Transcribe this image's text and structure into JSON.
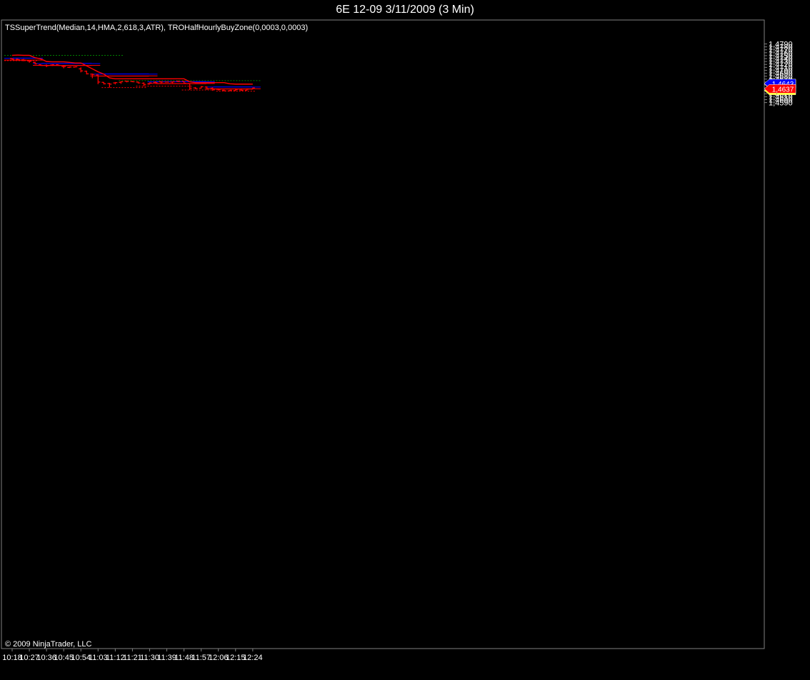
{
  "window": {
    "title": "6E 12-09  3/11/2009 (3 Min)"
  },
  "indicator_label": "TSSuperTrend(Median,14,HMA,2,618,3,ATR), TROHalfHourlyBuyZone(0,0003,0,0003)",
  "copyright": "© 2009 NinjaTrader, LLC",
  "colors": {
    "background": "#000000",
    "bars": "#ff0000",
    "supertrend": "#ff0000",
    "blue_zone": "#0000ff",
    "blue_zone_fill": "#000068",
    "red_zone_fill": "#6b0000",
    "red_zone_line": "#ff0000",
    "green_dotted": "#008000",
    "axis_text": "#ffffff",
    "frame": "#808080"
  },
  "price_markers": [
    {
      "label": "1,4653",
      "value": 1.4653,
      "color": "#ff0000"
    },
    {
      "label": "1,4643",
      "value": 1.4643,
      "color": "#0000ff"
    },
    {
      "label": "1,4641",
      "value": 1.4641,
      "color": "#ffff00"
    },
    {
      "label": "1,4637",
      "value": 1.4637,
      "color": "#ff0000"
    }
  ],
  "chart_data": {
    "type": "ohlc",
    "title": "6E 12-09  3/11/2009 (3 Min)",
    "ylim": [
      1.4582,
      1.4797
    ],
    "x_ticks": [
      "10:18",
      "10:27",
      "10:36",
      "10:45",
      "10:54",
      "11:03",
      "11:12",
      "11:21",
      "11:30",
      "11:39",
      "11:48",
      "11:57",
      "12:06",
      "12:15",
      "12:24"
    ],
    "x_tick_index": [
      0,
      3,
      6,
      9,
      12,
      15,
      18,
      21,
      24,
      27,
      30,
      33,
      36,
      39,
      42
    ],
    "y_ticks": [
      "1,4590",
      "1,4600",
      "1,4610",
      "1,4620",
      "1,4630",
      "1,4640",
      "1,4650",
      "1,4660",
      "1,4670",
      "1,4680",
      "1,4690",
      "1,4700",
      "1,4710",
      "1,4720",
      "1,4730",
      "1,4740",
      "1,4750",
      "1,4760",
      "1,4770",
      "1,4780",
      "1,4790"
    ],
    "y_tick_values": [
      1.459,
      1.46,
      1.461,
      1.462,
      1.463,
      1.464,
      1.465,
      1.466,
      1.467,
      1.468,
      1.469,
      1.47,
      1.471,
      1.472,
      1.473,
      1.474,
      1.475,
      1.476,
      1.477,
      1.478,
      1.479
    ],
    "bars": [
      {
        "t": "10:18",
        "o": 1.474,
        "h": 1.4742,
        "l": 1.4736,
        "c": 1.4738
      },
      {
        "t": "10:21",
        "o": 1.4738,
        "h": 1.474,
        "l": 1.4734,
        "c": 1.4736
      },
      {
        "t": "10:24",
        "o": 1.4736,
        "h": 1.4739,
        "l": 1.4731,
        "c": 1.4735
      },
      {
        "t": "10:27",
        "o": 1.4732,
        "h": 1.4733,
        "l": 1.4726,
        "c": 1.4731
      },
      {
        "t": "10:30",
        "o": 1.4727,
        "h": 1.473,
        "l": 1.472,
        "c": 1.4722
      },
      {
        "t": "10:33",
        "o": 1.4719,
        "h": 1.4721,
        "l": 1.4715,
        "c": 1.4717
      },
      {
        "t": "10:36",
        "o": 1.4717,
        "h": 1.472,
        "l": 1.4711,
        "c": 1.4716
      },
      {
        "t": "10:39",
        "o": 1.4718,
        "h": 1.4721,
        "l": 1.4715,
        "c": 1.4719
      },
      {
        "t": "10:42",
        "o": 1.4719,
        "h": 1.4721,
        "l": 1.4716,
        "c": 1.4717
      },
      {
        "t": "10:45",
        "o": 1.4713,
        "h": 1.4717,
        "l": 1.4707,
        "c": 1.4713
      },
      {
        "t": "10:48",
        "o": 1.471,
        "h": 1.4712,
        "l": 1.4708,
        "c": 1.4711
      },
      {
        "t": "10:51",
        "o": 1.4711,
        "h": 1.4713,
        "l": 1.471,
        "c": 1.4712
      },
      {
        "t": "10:54",
        "o": 1.4705,
        "h": 1.471,
        "l": 1.4693,
        "c": 1.4698
      },
      {
        "t": "10:57",
        "o": 1.4697,
        "h": 1.4699,
        "l": 1.4686,
        "c": 1.4688
      },
      {
        "t": "11:00",
        "o": 1.4687,
        "h": 1.4689,
        "l": 1.4673,
        "c": 1.4686
      },
      {
        "t": "11:03",
        "o": 1.4684,
        "h": 1.4686,
        "l": 1.4653,
        "c": 1.466
      },
      {
        "t": "11:06",
        "o": 1.4659,
        "h": 1.466,
        "l": 1.4652,
        "c": 1.4654
      },
      {
        "t": "11:09",
        "o": 1.4655,
        "h": 1.4657,
        "l": 1.4641,
        "c": 1.4653
      },
      {
        "t": "11:12",
        "o": 1.4657,
        "h": 1.466,
        "l": 1.4652,
        "c": 1.4658
      },
      {
        "t": "11:15",
        "o": 1.4659,
        "h": 1.4663,
        "l": 1.4654,
        "c": 1.4661
      },
      {
        "t": "11:18",
        "o": 1.4663,
        "h": 1.4665,
        "l": 1.4659,
        "c": 1.4662
      },
      {
        "t": "11:21",
        "o": 1.4662,
        "h": 1.4664,
        "l": 1.466,
        "c": 1.4661
      },
      {
        "t": "11:24",
        "o": 1.466,
        "h": 1.4662,
        "l": 1.4655,
        "c": 1.4657
      },
      {
        "t": "11:27",
        "o": 1.4656,
        "h": 1.4659,
        "l": 1.4646,
        "c": 1.4652
      },
      {
        "t": "11:30",
        "o": 1.4653,
        "h": 1.4659,
        "l": 1.4652,
        "c": 1.4657
      },
      {
        "t": "11:33",
        "o": 1.4659,
        "h": 1.4663,
        "l": 1.4657,
        "c": 1.4658
      },
      {
        "t": "11:36",
        "o": 1.4661,
        "h": 1.4663,
        "l": 1.4656,
        "c": 1.466
      },
      {
        "t": "11:39",
        "o": 1.466,
        "h": 1.4661,
        "l": 1.4659,
        "c": 1.466
      },
      {
        "t": "11:42",
        "o": 1.466,
        "h": 1.4662,
        "l": 1.4656,
        "c": 1.4661
      },
      {
        "t": "11:45",
        "o": 1.4663,
        "h": 1.4665,
        "l": 1.466,
        "c": 1.4662
      },
      {
        "t": "11:48",
        "o": 1.4663,
        "h": 1.4664,
        "l": 1.4655,
        "c": 1.4656
      },
      {
        "t": "11:51",
        "o": 1.4655,
        "h": 1.4656,
        "l": 1.4633,
        "c": 1.4639
      },
      {
        "t": "11:54",
        "o": 1.464,
        "h": 1.4643,
        "l": 1.4636,
        "c": 1.4638
      },
      {
        "t": "11:57",
        "o": 1.4639,
        "h": 1.4646,
        "l": 1.4638,
        "c": 1.4644
      },
      {
        "t": "12:00",
        "o": 1.4643,
        "h": 1.4645,
        "l": 1.4634,
        "c": 1.4637
      },
      {
        "t": "12:03",
        "o": 1.4639,
        "h": 1.4642,
        "l": 1.463,
        "c": 1.4636
      },
      {
        "t": "12:06",
        "o": 1.4635,
        "h": 1.4638,
        "l": 1.4631,
        "c": 1.4634
      },
      {
        "t": "12:09",
        "o": 1.4632,
        "h": 1.4634,
        "l": 1.4629,
        "c": 1.463
      },
      {
        "t": "12:12",
        "o": 1.463,
        "h": 1.4633,
        "l": 1.4629,
        "c": 1.4632
      },
      {
        "t": "12:15",
        "o": 1.4631,
        "h": 1.4638,
        "l": 1.463,
        "c": 1.4634
      },
      {
        "t": "12:18",
        "o": 1.4633,
        "h": 1.4638,
        "l": 1.463,
        "c": 1.4632
      },
      {
        "t": "12:21",
        "o": 1.4632,
        "h": 1.4638,
        "l": 1.4631,
        "c": 1.4636
      },
      {
        "t": "12:24",
        "o": 1.4636,
        "h": 1.4641,
        "l": 1.4635,
        "c": 1.464
      }
    ],
    "supertrend": [
      {
        "t": "10:18",
        "v": 1.4751
      },
      {
        "t": "10:21",
        "v": 1.4752
      },
      {
        "t": "10:24",
        "v": 1.4751
      },
      {
        "t": "10:27",
        "v": 1.4751
      },
      {
        "t": "10:30",
        "v": 1.4743
      },
      {
        "t": "10:33",
        "v": 1.4739
      },
      {
        "t": "10:36",
        "v": 1.473
      },
      {
        "t": "10:39",
        "v": 1.4729
      },
      {
        "t": "10:42",
        "v": 1.4729
      },
      {
        "t": "10:45",
        "v": 1.4729
      },
      {
        "t": "10:48",
        "v": 1.4727
      },
      {
        "t": "10:51",
        "v": 1.4725
      },
      {
        "t": "10:54",
        "v": 1.4725
      },
      {
        "t": "10:57",
        "v": 1.4715
      },
      {
        "t": "11:00",
        "v": 1.4705
      },
      {
        "t": "11:03",
        "v": 1.4695
      },
      {
        "t": "11:06",
        "v": 1.4687
      },
      {
        "t": "11:09",
        "v": 1.4674
      },
      {
        "t": "11:12",
        "v": 1.4671
      },
      {
        "t": "11:48",
        "v": 1.4671
      },
      {
        "t": "11:51",
        "v": 1.4661
      },
      {
        "t": "11:54",
        "v": 1.4658
      },
      {
        "t": "12:06",
        "v": 1.4658
      },
      {
        "t": "12:09",
        "v": 1.4658
      },
      {
        "t": "12:12",
        "v": 1.4654
      },
      {
        "t": "12:15",
        "v": 1.4653
      },
      {
        "t": "12:24",
        "v": 1.4653
      }
    ],
    "zones": [
      {
        "from": "10:18",
        "to": "10:30",
        "blue_top": 1.4744,
        "blue_line": 1.4741,
        "red_line": 1.4735,
        "red_bottom": 1.4732
      },
      {
        "from": "10:33",
        "to": "11:00",
        "blue_top": 1.4726,
        "blue_line": 1.4723,
        "red_line": 1.4717,
        "red_bottom": 1.4714
      },
      {
        "from": "11:03",
        "to": "11:30",
        "blue_top": 1.469,
        "blue_line": 1.4687,
        "red_line": 1.4681,
        "red_bottom": 1.4678
      },
      {
        "from": "11:33",
        "to": "12:00",
        "blue_top": 1.4664,
        "blue_line": 1.4661,
        "red_line": 1.4655,
        "red_bottom": 1.4652
      },
      {
        "from": "12:03",
        "to": "12:24",
        "blue_top": 1.4646,
        "blue_line": 1.4643,
        "red_line": 1.4637,
        "red_bottom": 1.4634
      }
    ],
    "dotted_lines": [
      {
        "color": "green",
        "value": 1.4751,
        "from": "10:18",
        "to": "11:12"
      },
      {
        "color": "red",
        "value": 1.4733,
        "from": "10:18",
        "to": "10:27"
      },
      {
        "color": "red",
        "value": 1.4641,
        "from": "11:09",
        "to": "11:24"
      },
      {
        "color": "green",
        "value": 1.4665,
        "from": "11:18",
        "to": "12:24"
      },
      {
        "color": "red",
        "value": 1.4646,
        "from": "11:27",
        "to": "11:48"
      },
      {
        "color": "red",
        "value": 1.4633,
        "from": "11:51",
        "to": "12:00"
      },
      {
        "color": "red",
        "value": 1.4629,
        "from": "12:09",
        "to": "12:21"
      }
    ]
  }
}
